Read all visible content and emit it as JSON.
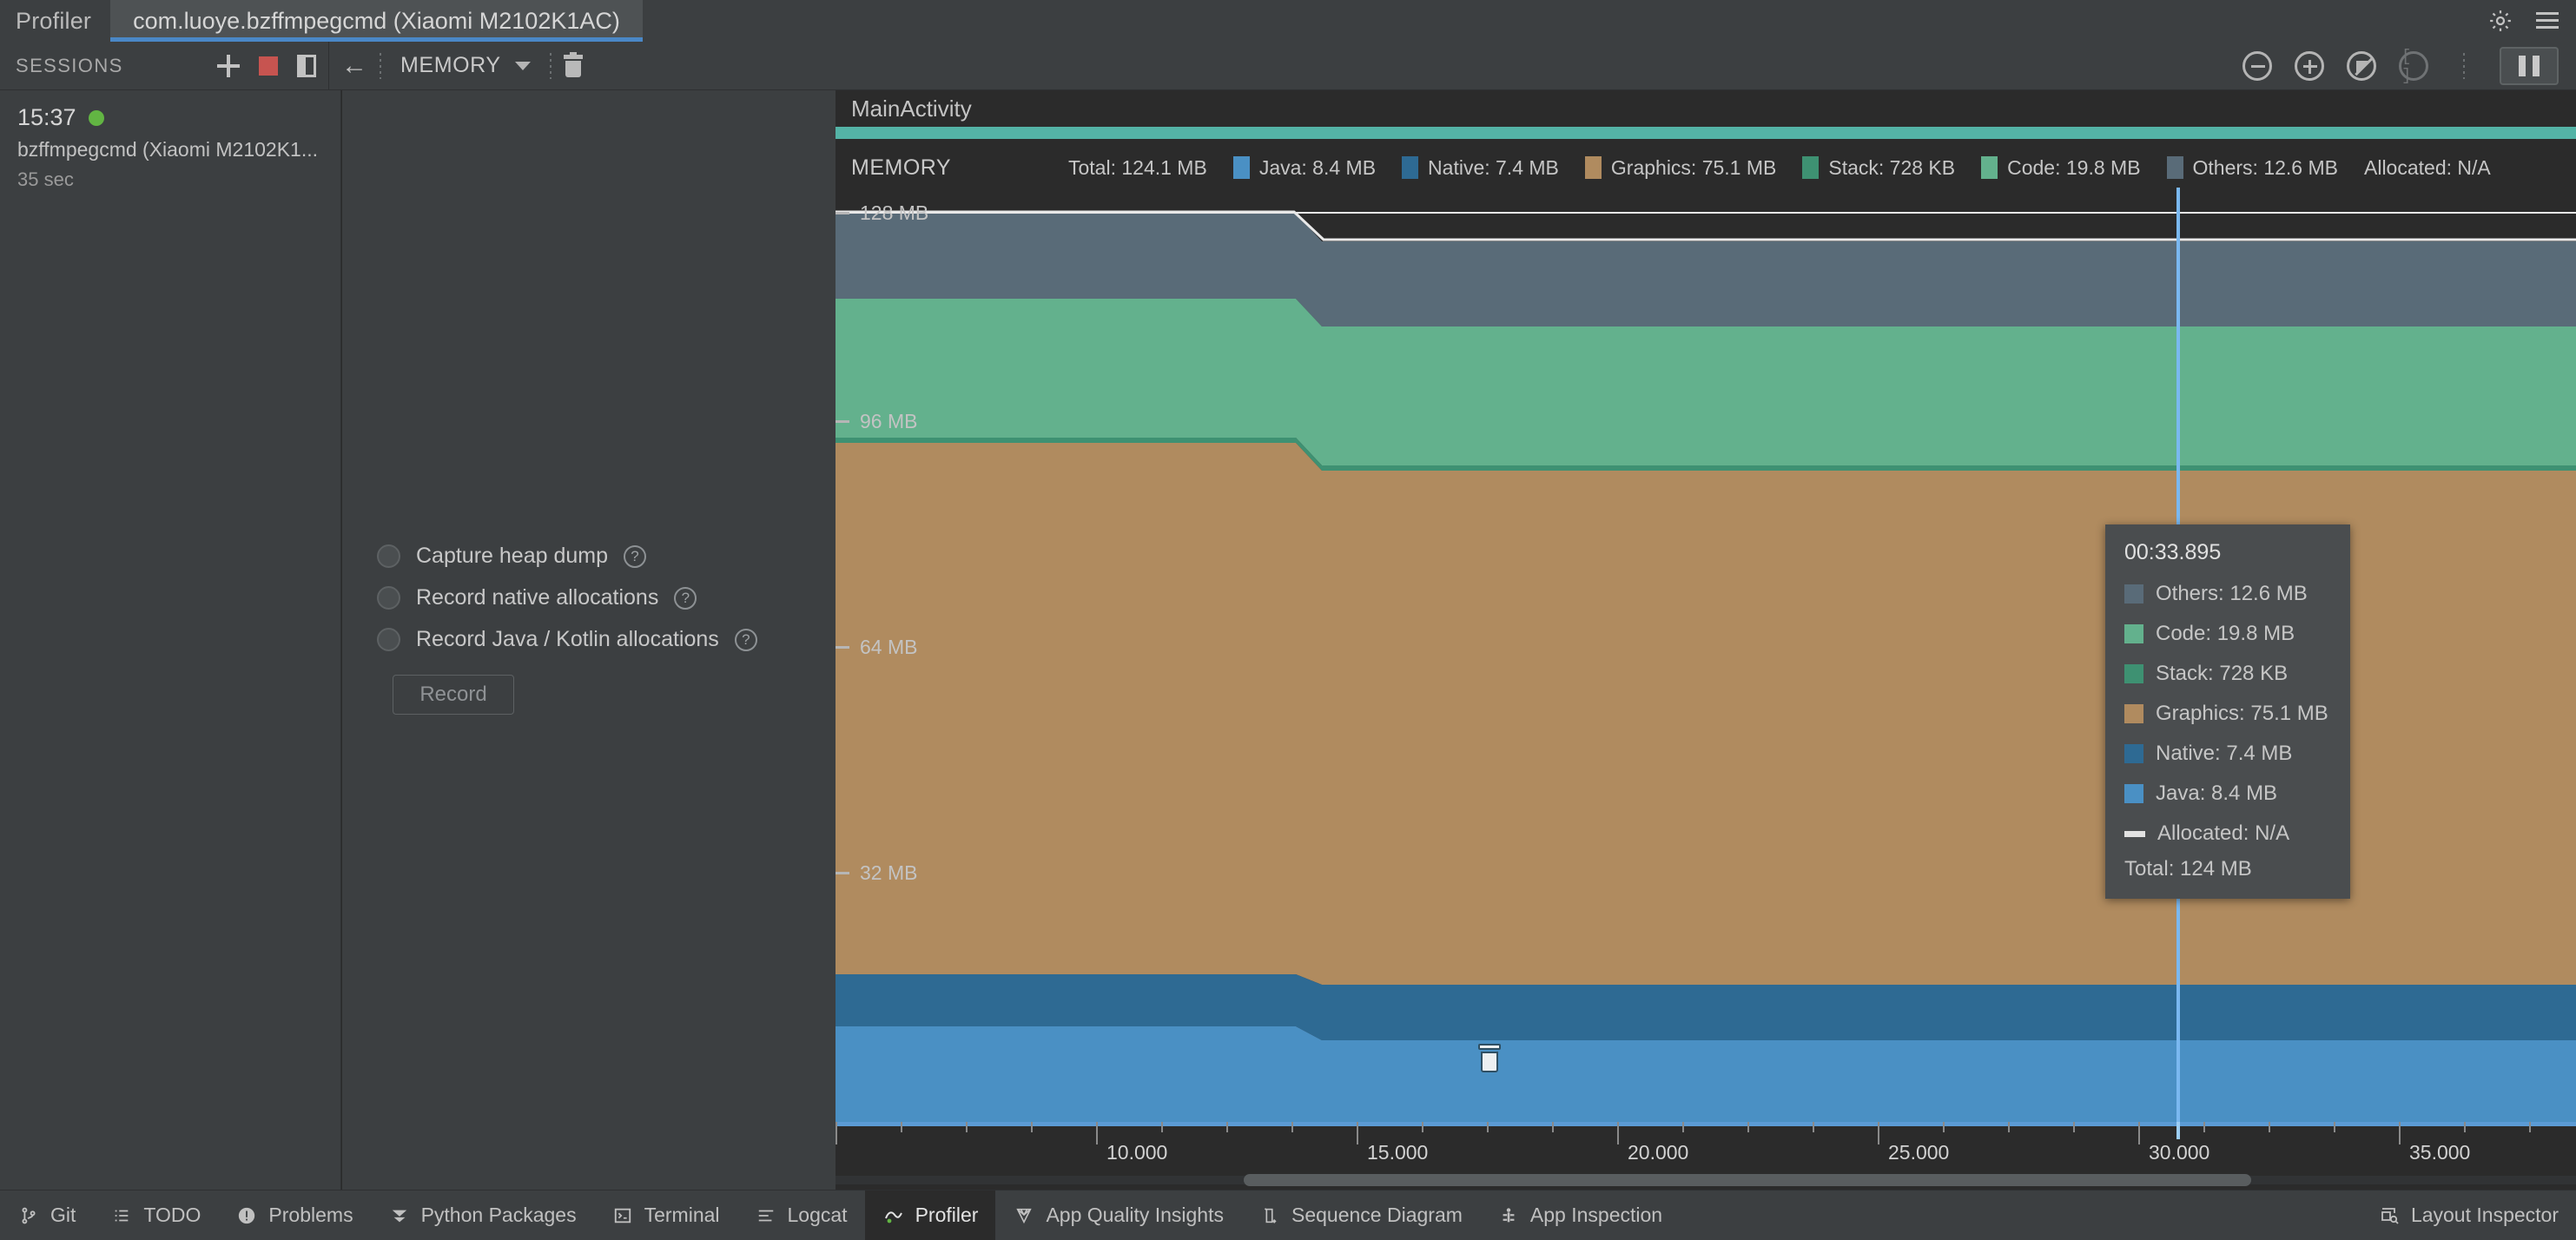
{
  "window": {
    "app_title": "Profiler",
    "tab_label": "com.luoye.bzffmpegcmd (Xiaomi M2102K1AC)",
    "accent": "#4a88c7"
  },
  "toolbar": {
    "sessions_label": "SESSIONS",
    "add_session_icon": "plus-icon",
    "stop_session_icon": "stop-icon",
    "toggle_panel_icon": "panel-icon",
    "back_icon": "back-arrow-icon",
    "monitor_name": "MEMORY",
    "dropdown_icon": "chevron-down-icon",
    "trash_icon": "trash-icon",
    "zoom_out_icon": "zoom-out-icon",
    "zoom_in_icon": "zoom-in-icon",
    "reset_zoom_icon": "reset-zoom-icon",
    "attach_live_icon": "attach-to-live-icon",
    "pause_icon": "pause-icon",
    "settings_icon": "gear-icon",
    "menu_icon": "hamburger-icon"
  },
  "sessions": {
    "items": [
      {
        "time": "15:37",
        "name": "bzffmpegcmd (Xiaomi M2102K1...",
        "duration": "35 sec",
        "status_color": "#62b543"
      }
    ]
  },
  "capture": {
    "options": [
      {
        "label": "Capture heap dump",
        "help": "?"
      },
      {
        "label": "Record native allocations",
        "help": "?"
      },
      {
        "label": "Record Java / Kotlin allocations",
        "help": "?"
      }
    ],
    "record_button": "Record"
  },
  "events": {
    "activity_label": "MainActivity",
    "activity_color": "#54b3a6"
  },
  "memory_header": {
    "title": "MEMORY",
    "legend": [
      {
        "label": "Total: 124.1 MB",
        "color": null
      },
      {
        "label": "Java: 8.4 MB",
        "color": "#4a90c4"
      },
      {
        "label": "Native: 7.4 MB",
        "color": "#2e6a93"
      },
      {
        "label": "Graphics: 75.1 MB",
        "color": "#b08b5f"
      },
      {
        "label": "Stack: 728 KB",
        "color": "#3e9172"
      },
      {
        "label": "Code: 19.8 MB",
        "color": "#63b18d"
      },
      {
        "label": "Others: 12.6 MB",
        "color": "#596b78"
      },
      {
        "label": "Allocated: N/A",
        "color": null
      }
    ]
  },
  "tooltip": {
    "time": "00:33.895",
    "rows": [
      {
        "label": "Others: 12.6 MB",
        "color": "#596b78",
        "style": "swatch"
      },
      {
        "label": "Code: 19.8 MB",
        "color": "#63b18d",
        "style": "swatch"
      },
      {
        "label": "Stack: 728 KB",
        "color": "#3e9172",
        "style": "swatch"
      },
      {
        "label": "Graphics: 75.1 MB",
        "color": "#b08b5f",
        "style": "swatch"
      },
      {
        "label": "Native: 7.4 MB",
        "color": "#2e6a93",
        "style": "swatch"
      },
      {
        "label": "Java: 8.4 MB",
        "color": "#4a90c4",
        "style": "swatch"
      },
      {
        "label": "Allocated: N/A",
        "color": "#e2e2e2",
        "style": "dash"
      }
    ],
    "total": "Total: 124 MB"
  },
  "chart_data": {
    "type": "area",
    "title": "MEMORY",
    "xlabel": "",
    "ylabel": "MB",
    "ylim": [
      0,
      136
    ],
    "xlim": [
      7.5,
      35.2
    ],
    "grid": false,
    "legend_position": "top",
    "y_ticks": [
      "128 MB",
      "96 MB",
      "64 MB",
      "32 MB"
    ],
    "y_tick_values": [
      128,
      96,
      64,
      32
    ],
    "x_ticks": [
      "10.000",
      "15.000",
      "20.000",
      "25.000",
      "30.000",
      "35.000"
    ],
    "x_tick_values": [
      10,
      15,
      20,
      25,
      30,
      35
    ],
    "stacked": true,
    "series": [
      {
        "name": "Java",
        "color": "#4a90c4",
        "values": [
          8.4,
          8.4,
          8.4,
          8.4
        ]
      },
      {
        "name": "Native",
        "color": "#2e6a93",
        "values": [
          9.2,
          9.2,
          7.4,
          7.4
        ]
      },
      {
        "name": "Graphics",
        "color": "#b08b5f",
        "values": [
          78.6,
          78.6,
          75.1,
          75.1
        ]
      },
      {
        "name": "Stack",
        "color": "#3e9172",
        "values": [
          0.71,
          0.71,
          0.71,
          0.71
        ]
      },
      {
        "name": "Code",
        "color": "#63b18d",
        "values": [
          19.8,
          19.8,
          19.8,
          19.8
        ]
      },
      {
        "name": "Others",
        "color": "#596b78",
        "values": [
          12.6,
          12.6,
          12.6,
          12.6
        ]
      }
    ],
    "total_line": {
      "name": "Total",
      "color": "#e8e8e8",
      "values": [
        129.3,
        129.3,
        124.1,
        124.1
      ]
    },
    "markers": [
      {
        "type": "gc",
        "x": 17.1,
        "icon": "trash-icon"
      }
    ],
    "playhead": {
      "time": "00:33.895",
      "x": 33.895,
      "color": "#7ab8f0"
    }
  },
  "statusbar": {
    "left_items": [
      {
        "label": "Git",
        "icon": "git-branch-icon"
      },
      {
        "label": "TODO",
        "icon": "list-icon"
      },
      {
        "label": "Problems",
        "icon": "warning-circle-icon"
      },
      {
        "label": "Python Packages",
        "icon": "chevrons-down-icon"
      },
      {
        "label": "Terminal",
        "icon": "terminal-icon"
      },
      {
        "label": "Logcat",
        "icon": "lines-icon"
      },
      {
        "label": "Profiler",
        "icon": "profiler-icon",
        "active": true
      },
      {
        "label": "App Quality Insights",
        "icon": "gem-icon"
      },
      {
        "label": "Sequence Diagram",
        "icon": "sequence-icon"
      },
      {
        "label": "App Inspection",
        "icon": "inspection-icon"
      }
    ],
    "right_items": [
      {
        "label": "Layout Inspector",
        "icon": "layout-inspector-icon"
      }
    ]
  }
}
